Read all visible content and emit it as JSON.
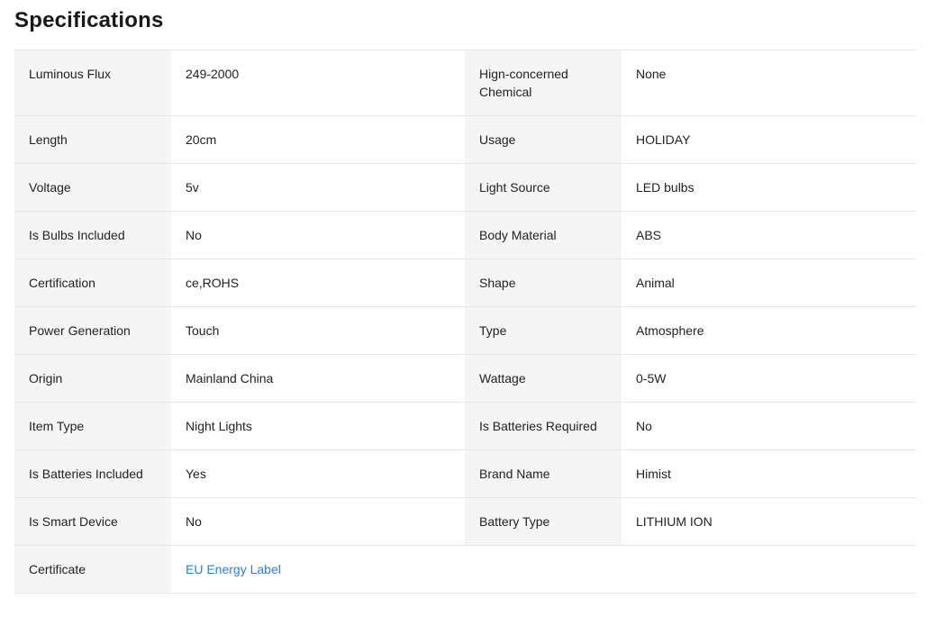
{
  "title": "Specifications",
  "rows": [
    {
      "k1": "Luminous Flux",
      "v1": "249-2000",
      "k2": "Hign-concerned Chemical",
      "v2": "None"
    },
    {
      "k1": "Length",
      "v1": "20cm",
      "k2": "Usage",
      "v2": "HOLIDAY"
    },
    {
      "k1": "Voltage",
      "v1": "5v",
      "k2": "Light Source",
      "v2": "LED bulbs"
    },
    {
      "k1": "Is Bulbs Included",
      "v1": "No",
      "k2": "Body Material",
      "v2": "ABS"
    },
    {
      "k1": "Certification",
      "v1": "ce,ROHS",
      "k2": "Shape",
      "v2": "Animal"
    },
    {
      "k1": "Power Generation",
      "v1": "Touch",
      "k2": "Type",
      "v2": "Atmosphere"
    },
    {
      "k1": "Origin",
      "v1": "Mainland China",
      "k2": "Wattage",
      "v2": "0-5W"
    },
    {
      "k1": "Item Type",
      "v1": "Night Lights",
      "k2": "Is Batteries Required",
      "v2": "No"
    },
    {
      "k1": "Is Batteries Included",
      "v1": "Yes",
      "k2": "Brand Name",
      "v2": "Himist"
    },
    {
      "k1": "Is Smart Device",
      "v1": "No",
      "k2": "Battery Type",
      "v2": "LITHIUM ION"
    },
    {
      "k1": "Certificate",
      "v1": "EU Energy Label"
    }
  ],
  "colors": {
    "link": "#2f7ed8",
    "key_bg": "#f5f5f5",
    "border": "#e6e6e6"
  }
}
